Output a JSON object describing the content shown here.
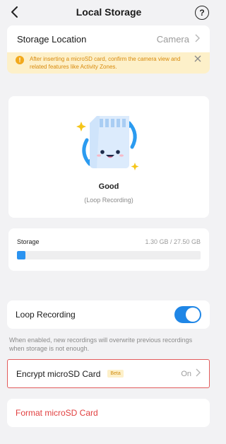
{
  "header": {
    "title": "Local Storage",
    "help_label": "?"
  },
  "storage_location": {
    "label": "Storage Location",
    "value": "Camera"
  },
  "notice": {
    "text": "After inserting a microSD card, confirm the camera view and related features like Activity Zones."
  },
  "status": {
    "title": "Good",
    "subtitle": "(Loop Recording)"
  },
  "storage": {
    "label": "Storage",
    "value": "1.30 GB / 27.50 GB",
    "used_fraction": 0.047
  },
  "loop_recording": {
    "label": "Loop Recording",
    "enabled": true,
    "note": "When enabled, new recordings will overwrite previous recordings when storage is not enough."
  },
  "encrypt": {
    "label": "Encrypt microSD Card",
    "badge": "Beta",
    "value": "On"
  },
  "format": {
    "label": "Format microSD Card"
  },
  "colors": {
    "accent": "#1f86e6",
    "danger": "#e13f3f",
    "warning_bg": "#fdf0c9",
    "warning_text": "#d88a0c"
  },
  "icons": [
    "back-arrow-icon",
    "help-icon",
    "chevron-right-icon",
    "warning-icon",
    "close-icon",
    "sd-card-illustration"
  ]
}
